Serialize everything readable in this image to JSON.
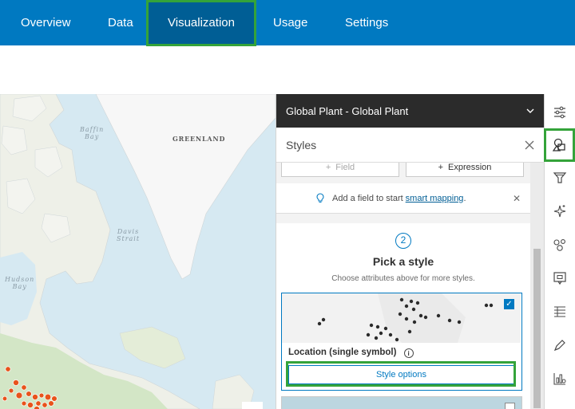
{
  "nav": {
    "tabs": [
      {
        "label": "Overview"
      },
      {
        "label": "Data"
      },
      {
        "label": "Visualization"
      },
      {
        "label": "Usage"
      },
      {
        "label": "Settings"
      }
    ],
    "active_tab": "Visualization"
  },
  "map": {
    "labels": {
      "baffin_bay": "Baffin\nBay",
      "greenland": "GREENLAND",
      "davis_strait": "Davis\nStrait",
      "hudson_bay": "Hudson\nBay"
    }
  },
  "panel": {
    "layer_title": "Global Plant - Global Plant",
    "section_title": "Styles",
    "field_button": "Field",
    "expression_button": "Expression",
    "hint_text": "Add a field to start",
    "hint_link": "smart mapping",
    "hint_period": ".",
    "step_number": "2",
    "pick_title": "Pick a style",
    "pick_subtitle": "Choose attributes above for more styles.",
    "style_card": {
      "label": "Location (single symbol)",
      "checked": true,
      "options_button": "Style options"
    }
  },
  "toolbar": {
    "tools": [
      "properties-icon",
      "styles-icon",
      "filter-icon",
      "effects-icon",
      "clustering-icon",
      "popups-icon",
      "fields-icon",
      "labels-icon",
      "charts-icon"
    ]
  },
  "colors": {
    "nav_bg": "#0079c1",
    "nav_active": "#005e95",
    "highlight": "#34a33a",
    "accent": "#0079c1",
    "panel_header": "#2b2b2b"
  }
}
